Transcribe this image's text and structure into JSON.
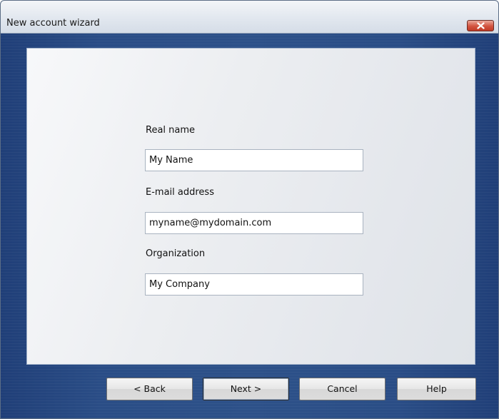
{
  "window": {
    "title": "New account wizard",
    "close_icon": "close-icon"
  },
  "form": {
    "real_name": {
      "label": "Real name",
      "value": "My Name"
    },
    "email": {
      "label": "E-mail address",
      "value": "myname@mydomain.com"
    },
    "organization": {
      "label": "Organization",
      "value": "My Company"
    }
  },
  "buttons": {
    "back": "< Back",
    "next": "Next >",
    "cancel": "Cancel",
    "help": "Help"
  },
  "colors": {
    "frame": "#2a4d86",
    "close_button": "#d2533f"
  }
}
